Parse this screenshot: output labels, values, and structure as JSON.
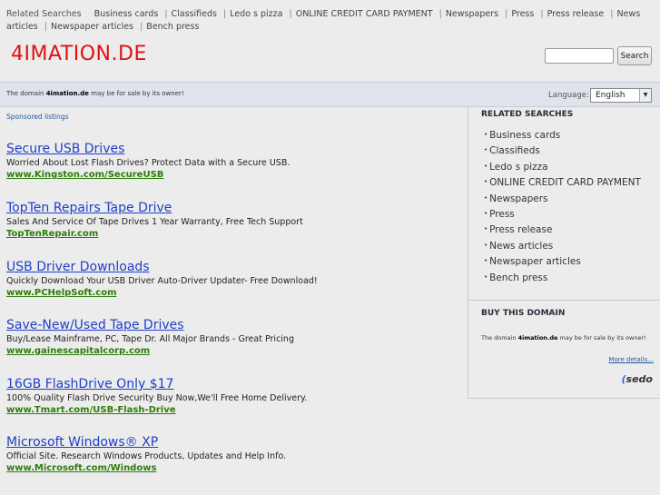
{
  "top_links": {
    "label": "Related Searches",
    "items": [
      "Business cards",
      "Classifieds",
      "Ledo s pizza",
      "ONLINE CREDIT CARD PAYMENT",
      "Newspapers",
      "Press",
      "Press release",
      "News articles",
      "Newspaper articles",
      "Bench press"
    ]
  },
  "logo": "4IMATION.DE",
  "search": {
    "button_label": "Search",
    "placeholder": ""
  },
  "notice": {
    "prefix": "The domain ",
    "domain": "4imation.de",
    "suffix": " may be for sale by its owner!"
  },
  "language": {
    "label": "Language:",
    "selected": "English"
  },
  "sponsored_label": "Sponsored listings",
  "listings": [
    {
      "title": "Secure USB Drives",
      "desc": "Worried About Lost Flash Drives? Protect Data with a Secure USB.",
      "url": "www.Kingston.com/SecureUSB"
    },
    {
      "title": "TopTen Repairs Tape Drive",
      "desc": "Sales And Service Of Tape Drives 1 Year Warranty, Free Tech Support",
      "url": "TopTenRepair.com"
    },
    {
      "title": "USB Driver Downloads",
      "desc": "Quickly Download Your USB Driver Auto-Driver Updater- Free Download!",
      "url": "www.PCHelpSoft.com"
    },
    {
      "title": "Save-New/Used Tape Drives",
      "desc": "Buy/Lease Mainframe, PC, Tape Dr. All Major Brands - Great Pricing",
      "url": "www.gainescapitalcorp.com"
    },
    {
      "title": "16GB FlashDrive Only $17",
      "desc": "100% Quality Flash Drive Security Buy Now,We'll Free Home Delivery.",
      "url": "www.Tmart.com/USB-Flash-Drive"
    },
    {
      "title": "Microsoft Windows® XP",
      "desc": "Official Site. Research Windows Products, Updates and Help Info.",
      "url": "www.Microsoft.com/Windows"
    }
  ],
  "sidebar": {
    "related_heading": "RELATED SEARCHES",
    "related_items": [
      "Business cards",
      "Classifieds",
      "Ledo s pizza",
      "ONLINE CREDIT CARD PAYMENT",
      "Newspapers",
      "Press",
      "Press release",
      "News articles",
      "Newspaper articles",
      "Bench press"
    ],
    "buy_heading": "BUY THIS DOMAIN",
    "more_details": "More details...",
    "sedo_logo": "sedo"
  }
}
